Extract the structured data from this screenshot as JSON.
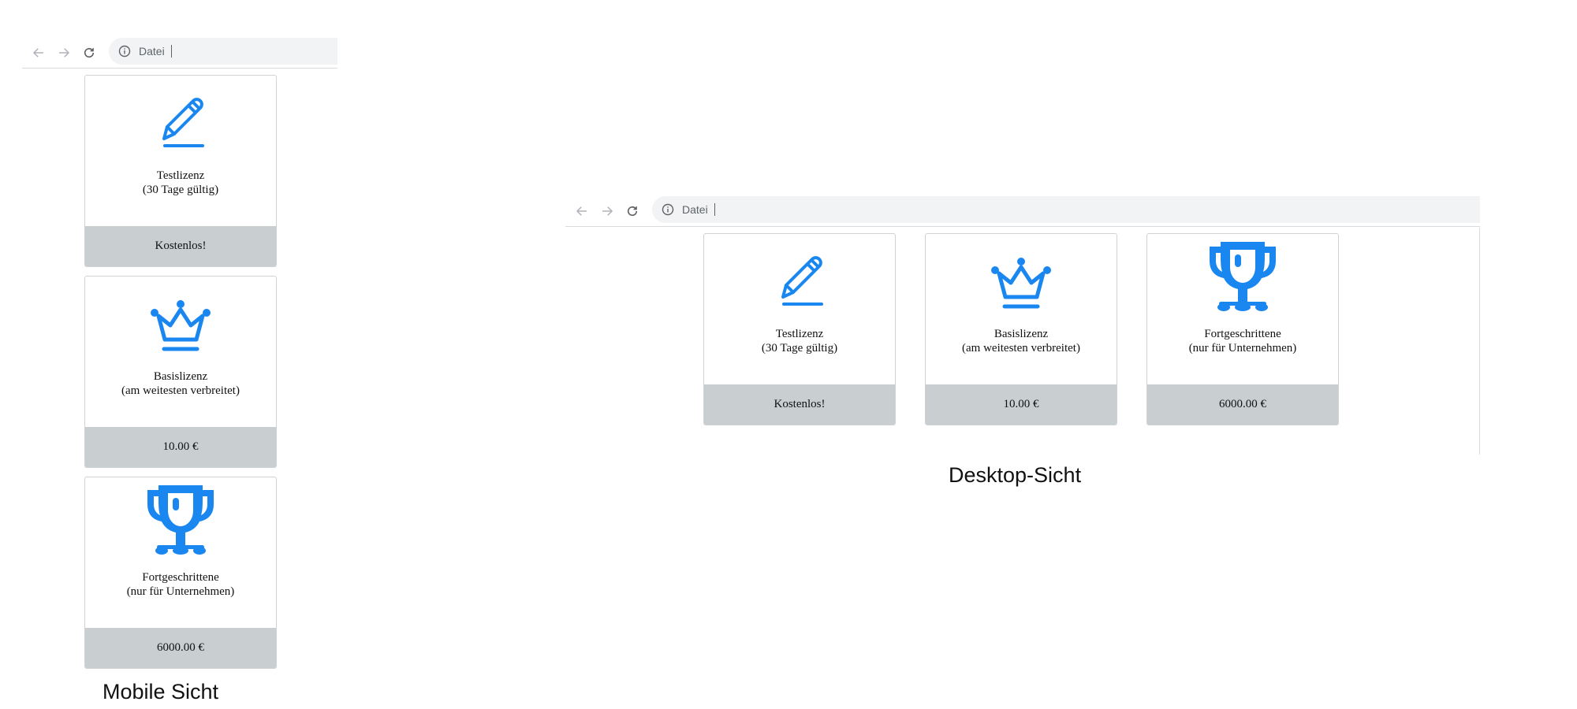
{
  "browser": {
    "back_icon": "arrow-left-icon",
    "forward_icon": "arrow-right-icon",
    "reload_icon": "reload-icon",
    "info_icon": "info-circle-icon",
    "url": "Datei"
  },
  "licenses": [
    {
      "icon": "pencil-icon",
      "title_line1": "Testlizenz",
      "title_line2": "(30 Tage gültig)",
      "price": "Kostenlos!"
    },
    {
      "icon": "crown-icon",
      "title_line1": "Basislizenz",
      "title_line2": "(am weitesten verbreitet)",
      "price": "10.00 €"
    },
    {
      "icon": "trophy-icon",
      "title_line1": "Fortgeschrittene",
      "title_line2": "(nur für Unternehmen)",
      "price": "6000.00 €"
    }
  ],
  "captions": {
    "mobile": "Mobile Sicht",
    "desktop": "Desktop-Sicht"
  },
  "colors": {
    "icon_blue": "#1a87f0",
    "price_bar": "#c9cfd1",
    "omnibox": "#f1f3f4"
  }
}
